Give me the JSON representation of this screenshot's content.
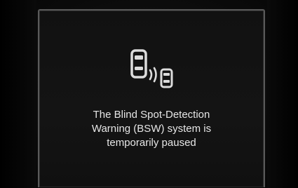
{
  "panel": {
    "icon": "blind-spot-detection-icon",
    "message_lines": [
      "The Blind Spot-Detection",
      "Warning (BSW) system is",
      "temporarily paused"
    ]
  },
  "colors": {
    "background": "#000000",
    "panel_border": "#5a5a5a",
    "text": "#e6e6e6",
    "icon": "#dcdcdc"
  }
}
